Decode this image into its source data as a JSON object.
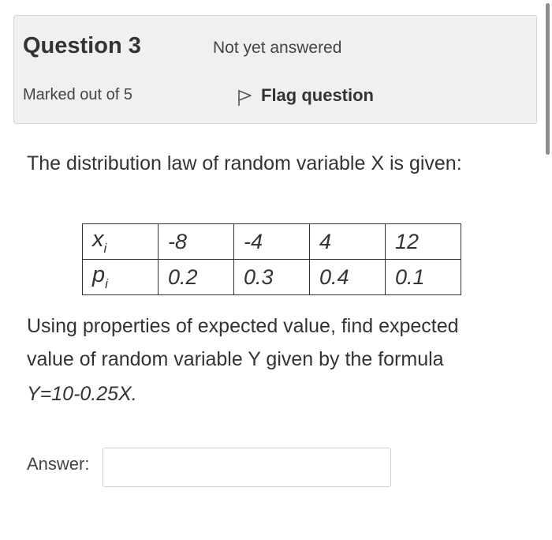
{
  "question": {
    "title": "Question 3",
    "status": "Not yet answered",
    "marks": "Marked out of 5",
    "flag_label": "Flag question"
  },
  "text": {
    "intro": "The distribution law of random variable X is given:",
    "task": "Using properties of expected value, find expected value of random variable Y given by the formula",
    "formula": "Y=10-0.25X."
  },
  "table": {
    "row_x": {
      "var": "x",
      "sub": "i",
      "values": [
        "-8",
        "-4",
        "4",
        "12"
      ]
    },
    "row_p": {
      "var": "p",
      "sub": "i",
      "values": [
        "0.2",
        "0.3",
        "0.4",
        "0.1"
      ]
    }
  },
  "answer": {
    "label": "Answer:",
    "value": "",
    "placeholder": ""
  },
  "icons": {
    "flag": "flag-icon"
  }
}
